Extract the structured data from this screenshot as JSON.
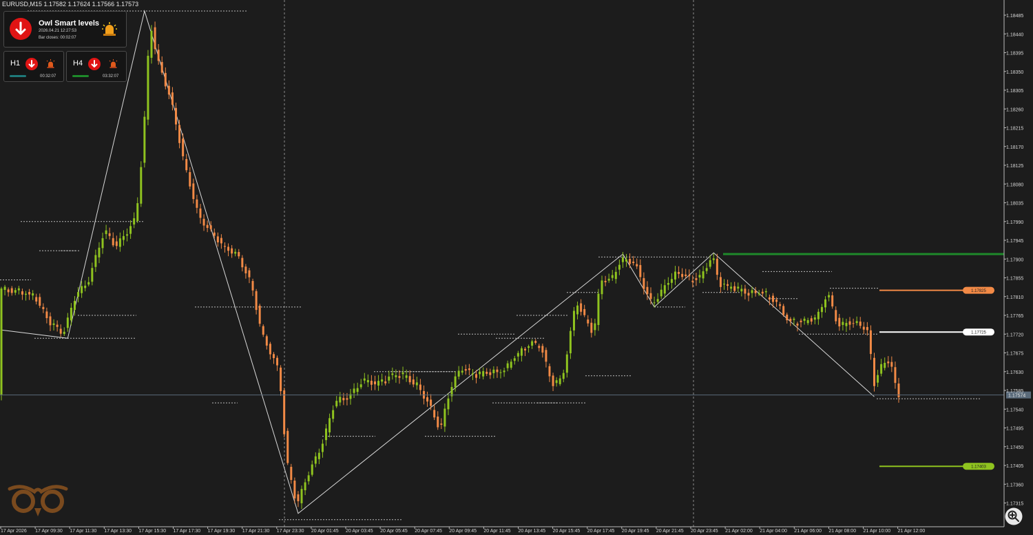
{
  "header": {
    "symbol_info": "EURUSD,M15  1.17582 1.17624 1.17566 1.17573"
  },
  "panel": {
    "title": "Owl Smart levels",
    "datetime": "2026.04.21 12:27:53",
    "bar_closes": "Bar closes: 00:02:07",
    "direction_icon": "arrow-down-icon",
    "alert_icon": "siren-icon"
  },
  "mini_panels": [
    {
      "timeframe": "H1",
      "timer": "00:32:07",
      "bar_color": "#1f7a7a",
      "direction_icon": "arrow-down-icon",
      "alert_icon": "siren-icon"
    },
    {
      "timeframe": "H4",
      "timer": "03:32:07",
      "bar_color": "#1e8a2a",
      "direction_icon": "arrow-down-icon",
      "alert_icon": "siren-icon"
    }
  ],
  "logo": {
    "name": "owl-logo-icon",
    "color": "#7a4a1e"
  },
  "zoom_icon": "zoom-in-icon",
  "colors": {
    "background": "#1c1c1c",
    "bull": "#8fc31f",
    "bear": "#f28a46",
    "axis_text": "#d8d8d8",
    "grid_sep": "#8a8a8a",
    "current_line": "#5a6a7a"
  },
  "chart_data": {
    "type": "candlestick",
    "symbol": "EURUSD",
    "timeframe": "M15",
    "price_axis_labels": [
      "1.18485",
      "1.18440",
      "1.18395",
      "1.18350",
      "1.18305",
      "1.18260",
      "1.18215",
      "1.18170",
      "1.18125",
      "1.18080",
      "1.18035",
      "1.17990",
      "1.17945",
      "1.17900",
      "1.17855",
      "1.17810",
      "1.17765",
      "1.17720",
      "1.17675",
      "1.17630",
      "1.17585",
      "1.17540",
      "1.17495",
      "1.17450",
      "1.17405",
      "1.17360",
      "1.17315"
    ],
    "time_axis_labels": [
      "17 Apr 2026",
      "17 Apr 09:30",
      "17 Apr 11:30",
      "17 Apr 13:30",
      "17 Apr 15:30",
      "17 Apr 17:30",
      "17 Apr 19:30",
      "17 Apr 21:30",
      "17 Apr 23:30",
      "20 Apr 01:45",
      "20 Apr 03:45",
      "20 Apr 05:45",
      "20 Apr 07:45",
      "20 Apr 09:45",
      "20 Apr 11:45",
      "20 Apr 13:45",
      "20 Apr 15:45",
      "20 Apr 17:45",
      "20 Apr 19:45",
      "20 Apr 21:45",
      "20 Apr 23:45",
      "21 Apr 02:00",
      "21 Apr 04:00",
      "21 Apr 06:00",
      "21 Apr 08:00",
      "21 Apr 10:00",
      "21 Apr 12:00"
    ],
    "current_price": "1.17574",
    "levels": [
      {
        "label": "1.17825",
        "price": 1.17825,
        "color": "#f28a46"
      },
      {
        "label": "1.17725",
        "price": 1.17725,
        "color": "#ffffff"
      },
      {
        "label": "1.17403",
        "price": 1.17403,
        "color": "#8fc31f"
      },
      {
        "label": "",
        "price": 1.17912,
        "color": "#1e8a2a"
      }
    ],
    "zigzag": [
      {
        "i": 0,
        "p": 1.1773
      },
      {
        "i": 19,
        "p": 1.1771
      },
      {
        "i": 41,
        "p": 1.18495
      },
      {
        "i": 85,
        "p": 1.1729
      },
      {
        "i": 178,
        "p": 1.17912
      },
      {
        "i": 187,
        "p": 1.17785
      },
      {
        "i": 204,
        "p": 1.17915
      },
      {
        "i": 250,
        "p": 1.1757
      }
    ],
    "waypoints": [
      [
        0,
        1.1783
      ],
      [
        6,
        1.1782
      ],
      [
        10,
        1.1781
      ],
      [
        14,
        1.1775
      ],
      [
        18,
        1.1772
      ],
      [
        22,
        1.1782
      ],
      [
        25,
        1.1784
      ],
      [
        28,
        1.1792
      ],
      [
        30,
        1.1797
      ],
      [
        33,
        1.1793
      ],
      [
        36,
        1.1796
      ],
      [
        39,
        1.18
      ],
      [
        41,
        1.1818
      ],
      [
        43,
        1.1847
      ],
      [
        45,
        1.1838
      ],
      [
        49,
        1.1828
      ],
      [
        53,
        1.1812
      ],
      [
        57,
        1.18
      ],
      [
        60,
        1.1797
      ],
      [
        64,
        1.1793
      ],
      [
        68,
        1.1791
      ],
      [
        72,
        1.1784
      ],
      [
        75,
        1.1772
      ],
      [
        80,
        1.1763
      ],
      [
        82,
        1.1742
      ],
      [
        85,
        1.1731
      ],
      [
        88,
        1.1738
      ],
      [
        92,
        1.1745
      ],
      [
        96,
        1.1756
      ],
      [
        100,
        1.1757
      ],
      [
        104,
        1.1761
      ],
      [
        108,
        1.176
      ],
      [
        112,
        1.1762
      ],
      [
        116,
        1.1762
      ],
      [
        120,
        1.1759
      ],
      [
        123,
        1.1755
      ],
      [
        126,
        1.1749
      ],
      [
        129,
        1.1759
      ],
      [
        132,
        1.1764
      ],
      [
        136,
        1.1762
      ],
      [
        140,
        1.1763
      ],
      [
        144,
        1.1763
      ],
      [
        148,
        1.1767
      ],
      [
        152,
        1.177
      ],
      [
        155,
        1.1769
      ],
      [
        158,
        1.176
      ],
      [
        161,
        1.1761
      ],
      [
        165,
        1.178
      ],
      [
        168,
        1.1775
      ],
      [
        170,
        1.1772
      ],
      [
        172,
        1.1785
      ],
      [
        175,
        1.1785
      ],
      [
        178,
        1.179
      ],
      [
        182,
        1.1789
      ],
      [
        185,
        1.1782
      ],
      [
        187,
        1.1779
      ],
      [
        190,
        1.1783
      ],
      [
        194,
        1.1787
      ],
      [
        198,
        1.1785
      ],
      [
        201,
        1.1786
      ],
      [
        204,
        1.1791
      ],
      [
        206,
        1.1784
      ],
      [
        210,
        1.1783
      ],
      [
        214,
        1.1782
      ],
      [
        218,
        1.1782
      ],
      [
        222,
        1.178
      ],
      [
        226,
        1.1775
      ],
      [
        230,
        1.1775
      ],
      [
        234,
        1.1776
      ],
      [
        237,
        1.1782
      ],
      [
        240,
        1.1774
      ],
      [
        244,
        1.1775
      ],
      [
        247,
        1.1774
      ],
      [
        249,
        1.1772
      ],
      [
        250,
        1.1759
      ],
      [
        252,
        1.1764
      ],
      [
        255,
        1.1766
      ],
      [
        257,
        1.1757
      ]
    ]
  }
}
